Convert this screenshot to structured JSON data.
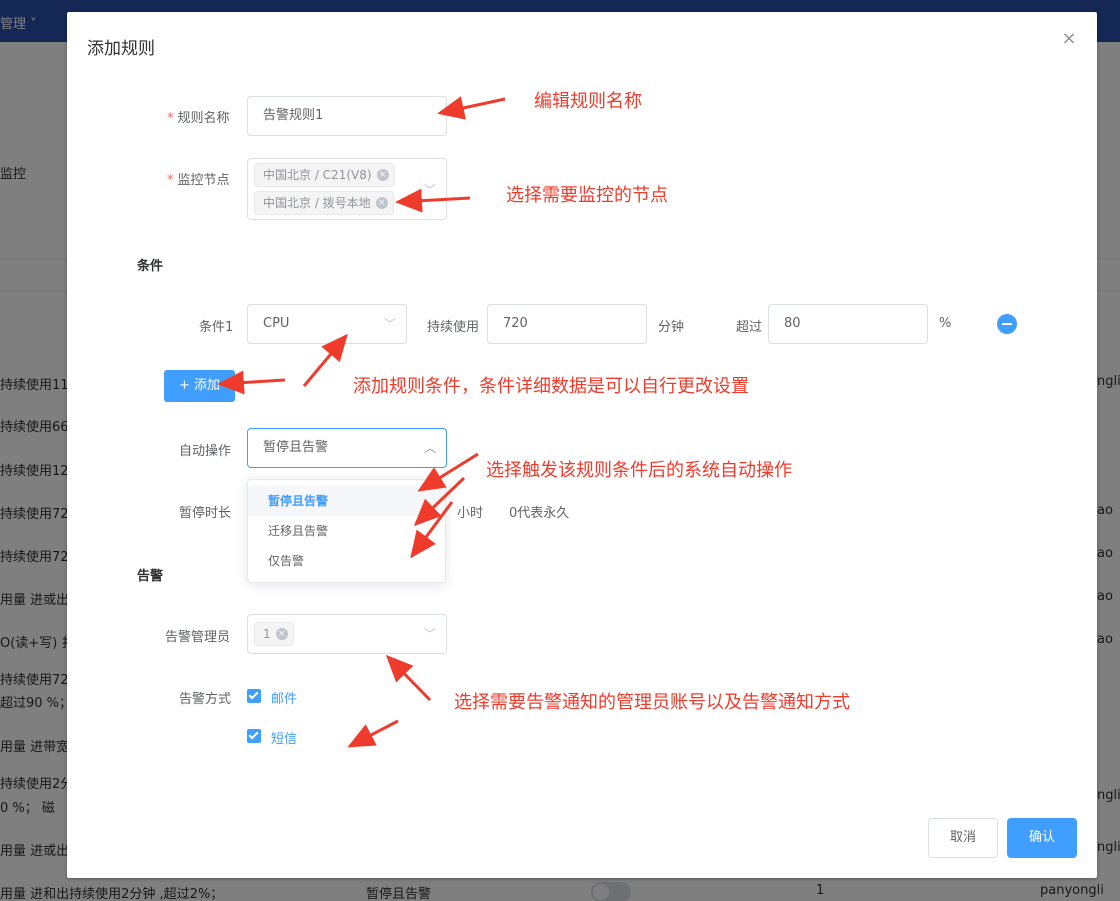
{
  "background": {
    "topbar_text": "管理 ˅",
    "column_header": "监控",
    "rows": [
      "持续使用11",
      "持续使用66",
      "持续使用12",
      "持续使用72",
      "持续使用72",
      "用量 进或出",
      "O(读+写) 扌",
      "持续使用72",
      "超过90 %；",
      "用量 进带宽",
      "持续使用2分",
      "0 %；    磁",
      "用量 进或出"
    ],
    "right_col": [
      "ngli",
      "ao",
      "ao",
      "ao",
      "ao",
      "ngli",
      "ngli"
    ],
    "bottom_row": {
      "text": "用量 进和出持续使用2分钟 ,超过2%；",
      "action": "暂停且告警",
      "count": "1",
      "user": "panyongli"
    }
  },
  "dialog": {
    "title": "添加规则",
    "close_icon": "×",
    "rule_name": {
      "label": "规则名称",
      "value": "告警规则1"
    },
    "monitor_node": {
      "label": "监控节点",
      "tags": [
        "中国北京 / C21(V8)",
        "中国北京 / 拨号本地"
      ]
    },
    "conditions": {
      "section": "条件",
      "row1": {
        "label": "条件1",
        "metric": "CPU",
        "duration_label": "持续使用",
        "duration_value": "720",
        "duration_unit": "分钟",
        "exceed_label": "超过",
        "exceed_value": "80",
        "exceed_unit": "%"
      },
      "add_button": "+ 添加"
    },
    "auto_action": {
      "label": "自动操作",
      "value": "暂停且告警",
      "options": [
        "暂停且告警",
        "迁移且告警",
        "仅告警"
      ]
    },
    "pause_duration": {
      "label": "暂停时长",
      "unit": "小时",
      "hint": "0代表永久"
    },
    "alert": {
      "section": "告警",
      "admin_label": "告警管理员",
      "admin_tags": [
        "1"
      ],
      "method_label": "告警方式",
      "methods": [
        "邮件",
        "短信"
      ]
    },
    "footer": {
      "cancel": "取消",
      "confirm": "确认"
    }
  },
  "annotations": {
    "edit_name": "编辑规则名称",
    "select_node": "选择需要监控的节点",
    "add_condition": "添加规则条件，条件详细数据是可以自行更改设置",
    "auto_action": "选择触发该规则条件后的系统自动操作",
    "alert_admin": "选择需要告警通知的管理员账号以及告警通知方式"
  },
  "colors": {
    "primary": "#409eff",
    "annotation": "#ef3b2c",
    "topbar": "#2b4eaa"
  }
}
